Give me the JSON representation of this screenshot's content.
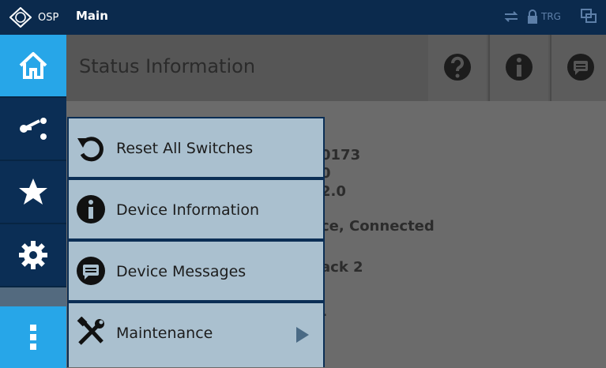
{
  "topbar": {
    "brand": "OSP",
    "title": "Main",
    "trg_label": "TRG"
  },
  "sidebar": {
    "items": [
      {
        "name": "home",
        "icon": "home-icon"
      },
      {
        "name": "connections",
        "icon": "switch-connection-icon"
      },
      {
        "name": "favorites",
        "icon": "star-icon"
      },
      {
        "name": "settings",
        "icon": "gear-icon"
      },
      {
        "name": "more",
        "icon": "vertical-dots-icon"
      }
    ]
  },
  "main": {
    "title": "Status Information",
    "header_buttons": [
      {
        "name": "help",
        "icon": "question-icon"
      },
      {
        "name": "info",
        "icon": "info-icon"
      },
      {
        "name": "messages",
        "icon": "message-icon"
      }
    ],
    "status_fragments": [
      "0173",
      "0",
      "2.0",
      "ce, Connected",
      "ack 2",
      "-"
    ]
  },
  "menu": {
    "items": [
      {
        "label": "Reset All Switches",
        "icon": "reset-icon"
      },
      {
        "label": "Device Information",
        "icon": "info-icon"
      },
      {
        "label": "Device Messages",
        "icon": "message-icon"
      },
      {
        "label": "Maintenance",
        "icon": "tools-icon",
        "submenu": true
      }
    ]
  },
  "colors": {
    "topbar": "#0b2a4d",
    "accent": "#27a6e8",
    "menu_item": "#aac0cf",
    "sidebar": "#072543"
  }
}
